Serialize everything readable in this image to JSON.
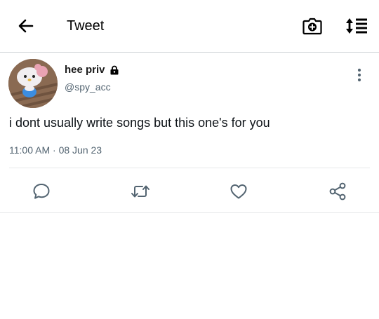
{
  "header": {
    "title": "Tweet",
    "icons": [
      "back-arrow-icon",
      "camera-add-icon",
      "sort-list-icon"
    ]
  },
  "tweet": {
    "display_name": "hee priv",
    "handle": "@spy_acc",
    "text": "i dont usually write songs but this one's for you",
    "time": "11:00 AM",
    "separator": "·",
    "date": "08 Jun 23",
    "protected_icon": "lock-icon",
    "actions": [
      "reply-icon",
      "retweet-icon",
      "like-icon",
      "share-icon"
    ]
  },
  "colors": {
    "text_primary": "#0f1419",
    "text_secondary": "#536471",
    "divider": "#e6e8ea",
    "icon": "#536471"
  }
}
